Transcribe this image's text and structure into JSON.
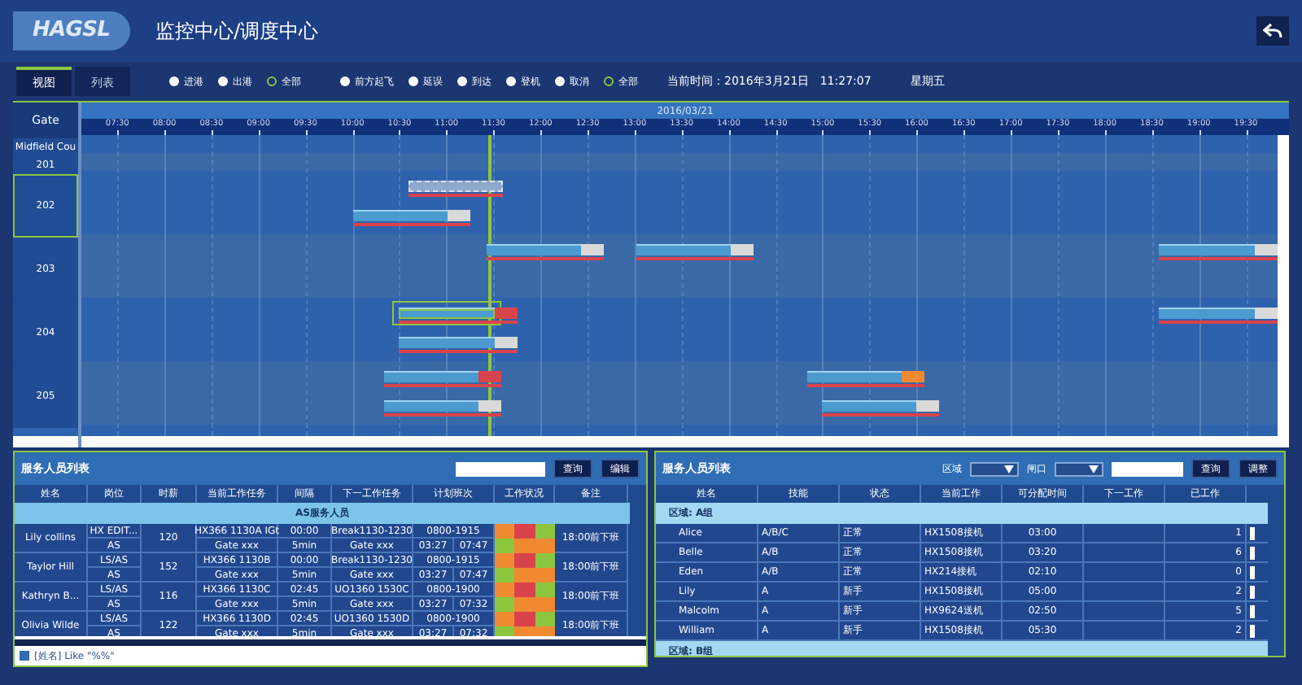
{
  "header": {
    "logo": "HAGSL",
    "title": "监控中心/调度中心"
  },
  "tabs": [
    {
      "label": "视图",
      "selected": true
    },
    {
      "label": "列表",
      "selected": false
    }
  ],
  "filter_groups": [
    [
      {
        "label": "进港",
        "selected": false
      },
      {
        "label": "出港",
        "selected": false
      },
      {
        "label": "全部",
        "selected": true
      }
    ],
    [
      {
        "label": "前方起飞",
        "selected": false
      },
      {
        "label": "延误",
        "selected": false
      },
      {
        "label": "到达",
        "selected": false
      },
      {
        "label": "登机",
        "selected": false
      },
      {
        "label": "取消",
        "selected": false
      },
      {
        "label": "全部",
        "selected": true
      }
    ]
  ],
  "current_time": "当前时间：2016年3月21日   11:27:07",
  "weekday": "星期五",
  "gantt": {
    "gate_header": "Gate",
    "date": "2016/03/21",
    "ticks": [
      "07:30",
      "08:00",
      "08:30",
      "09:00",
      "09:30",
      "10:00",
      "10:30",
      "11:00",
      "11:30",
      "12:00",
      "12:30",
      "13:00",
      "13:30",
      "14:00",
      "14:30",
      "15:00",
      "15:30",
      "16:00",
      "16:30",
      "17:00",
      "17:30",
      "18:00",
      "18:30",
      "19:00",
      "19:30"
    ],
    "rows": [
      {
        "gate": "Midfield Cou",
        "kind": "small",
        "selected": false
      },
      {
        "gate": "201",
        "kind": "small",
        "selected": false
      },
      {
        "gate": "202",
        "kind": "large",
        "selected": true,
        "bars": [
          {
            "kind": "pending",
            "selected": false
          },
          {
            "kind": "normal",
            "flag": {
              "kind": "plain"
            },
            "selected": false
          }
        ]
      },
      {
        "gate": "203",
        "kind": "large",
        "selected": false,
        "bars": [
          {
            "kind": "normal",
            "flag": {
              "kind": "plain"
            },
            "selected": false
          },
          {
            "kind": "normal",
            "flag": {
              "kind": "plain"
            },
            "selected": false
          },
          {
            "kind": "normal",
            "flag": {
              "kind": "plain"
            },
            "selected": false
          }
        ]
      },
      {
        "gate": "204",
        "kind": "large",
        "selected": false,
        "bars": [
          {
            "kind": "normal",
            "flag": {
              "kind": "alert"
            },
            "selected": true
          },
          {
            "kind": "normal",
            "flag": {
              "kind": "plain"
            },
            "selected": false
          },
          {
            "kind": "normal",
            "flag": {
              "kind": "plain"
            },
            "selected": false
          }
        ]
      },
      {
        "gate": "205",
        "kind": "large",
        "selected": false,
        "bars": [
          {
            "kind": "normal",
            "flag": {
              "kind": "alert"
            },
            "selected": false
          },
          {
            "kind": "normal",
            "flag": {
              "kind": "plain"
            },
            "selected": false
          },
          {
            "kind": "normal",
            "flag": {
              "kind": "warn"
            },
            "selected": false
          },
          {
            "kind": "normal",
            "flag": {
              "kind": "plain"
            },
            "selected": false
          }
        ]
      }
    ]
  },
  "staff_panel": {
    "title": "服务人员列表",
    "search_button": "查询",
    "edit_button": "编辑",
    "columns": [
      "姓名",
      "岗位",
      "时薪",
      "当前工作任务",
      "间隔",
      "下一工作任务",
      "计划班次",
      "工作状况",
      "备注"
    ],
    "group": "AS服务人员",
    "people": [
      {
        "name": "Lily collins",
        "wage": "120",
        "note": "18:00前下班",
        "lines": [
          {
            "post": "HX EDIT...",
            "task": "HX366 1130A IGt",
            "gap": "00:00",
            "next": "Break1130-1230",
            "shift": [
              "0800-1915"
            ],
            "status": [
              {
                "color": "#f08a30"
              },
              {
                "color": "#d9434b"
              },
              {
                "color": "#8cc63f"
              }
            ]
          },
          {
            "post": "AS",
            "task": "Gate xxx",
            "gap": "5min",
            "next": "Gate xxx",
            "shift": [
              "03:27",
              "07:47"
            ],
            "status": [
              {
                "color": "#8cc63f"
              },
              {
                "color": "#f08a30"
              },
              {
                "color": "#f08a30"
              }
            ]
          }
        ]
      },
      {
        "name": "Taylor Hill",
        "wage": "152",
        "note": "18:00前下班",
        "lines": [
          {
            "post": "LS/AS",
            "task": "HX366 1130B",
            "gap": "00:00",
            "next": "Break1130-1230",
            "shift": [
              "0800-1915"
            ],
            "status": [
              {
                "color": "#f08a30"
              },
              {
                "color": "#d9434b"
              },
              {
                "color": "#8cc63f"
              }
            ]
          },
          {
            "post": "AS",
            "task": "Gate xxx",
            "gap": "5min",
            "next": "Gate xxx",
            "shift": [
              "03:27",
              "07:47"
            ],
            "status": [
              {
                "color": "#8cc63f"
              },
              {
                "color": "#f08a30"
              },
              {
                "color": "#f08a30"
              }
            ]
          }
        ]
      },
      {
        "name": "Kathryn B...",
        "wage": "116",
        "note": "18:00前下班",
        "lines": [
          {
            "post": "LS/AS",
            "task": "HX366 1130C",
            "gap": "02:45",
            "next": "UO1360 1530C",
            "shift": [
              "0800-1900"
            ],
            "status": [
              {
                "color": "#f08a30"
              },
              {
                "color": "#d9434b"
              },
              {
                "color": "#8cc63f"
              }
            ]
          },
          {
            "post": "AS",
            "task": "Gate xxx",
            "gap": "5min",
            "next": "Gate xxx",
            "shift": [
              "03:27",
              "07:32"
            ],
            "status": [
              {
                "color": "#8cc63f"
              },
              {
                "color": "#f08a30"
              },
              {
                "color": "#f08a30"
              }
            ]
          }
        ]
      },
      {
        "name": "Olivia Wilde",
        "wage": "122",
        "note": "18:00前下班",
        "lines": [
          {
            "post": "LS/AS",
            "task": "HX366 1130D",
            "gap": "02:45",
            "next": "UO1360 1530D",
            "shift": [
              "0800-1900"
            ],
            "status": [
              {
                "color": "#f08a30"
              },
              {
                "color": "#d9434b"
              },
              {
                "color": "#8cc63f"
              }
            ]
          },
          {
            "post": "AS",
            "task": "Gate xxx",
            "gap": "5min",
            "next": "Gate xxx",
            "shift": [
              "03:27",
              "07:32"
            ],
            "status": [
              {
                "color": "#8cc63f"
              },
              {
                "color": "#f08a30"
              },
              {
                "color": "#f08a30"
              }
            ]
          }
        ]
      }
    ],
    "filter": {
      "checked": true,
      "text": "[姓名] Like \"%%\""
    }
  },
  "assign_panel": {
    "title": "服务人员列表",
    "area_label": "区域",
    "gate_label": "闸口",
    "search_button": "查询",
    "adjust_button": "调整",
    "columns": [
      "姓名",
      "技能",
      "状态",
      "当前工作",
      "可分配时间",
      "下一工作",
      "已工作"
    ],
    "groups": [
      {
        "label": "区域: A组",
        "rows": [
          {
            "name": "Alice",
            "skill": "A/B/C",
            "state": "正常",
            "current": "HX1508接机",
            "free": "03:00",
            "done": "1"
          },
          {
            "name": "Belle",
            "skill": "A/B",
            "state": "正常",
            "current": "HX1508接机",
            "free": "03:20",
            "done": "6"
          },
          {
            "name": "Eden",
            "skill": "A/B",
            "state": "正常",
            "current": "HX214接机",
            "free": "02:10",
            "done": "0"
          },
          {
            "name": "Lily",
            "skill": "A",
            "state": "新手",
            "current": "HX1508接机",
            "free": "05:00",
            "done": "2"
          },
          {
            "name": "Malcolm",
            "skill": "A",
            "state": "新手",
            "current": "HX9624送机",
            "free": "02:50",
            "done": "5"
          },
          {
            "name": "William",
            "skill": "A",
            "state": "新手",
            "current": "HX1508接机",
            "free": "05:30",
            "done": "2"
          }
        ]
      },
      {
        "label": "区域: B组"
      }
    ]
  }
}
